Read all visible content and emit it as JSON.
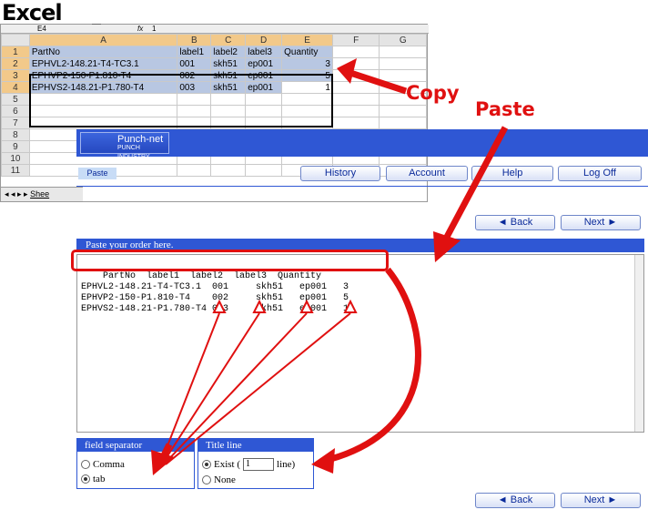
{
  "excel": {
    "title": "Excel",
    "name_box": "E4",
    "fx": "fx",
    "formula_value": "1",
    "columns": [
      "A",
      "B",
      "C",
      "D",
      "E",
      "F",
      "G"
    ],
    "rows": [
      {
        "num": "1",
        "cells": [
          "PartNo",
          "label1",
          "label2",
          "label3",
          "Quantity",
          "",
          ""
        ]
      },
      {
        "num": "2",
        "cells": [
          "EPHVL2-148.21-T4-TC3.1",
          "001",
          "skh51",
          "ep001",
          "3",
          "",
          ""
        ]
      },
      {
        "num": "3",
        "cells": [
          "EPHVP2-150-P1.810-T4",
          "002",
          "skh51",
          "ep001",
          "5",
          "",
          ""
        ]
      },
      {
        "num": "4",
        "cells": [
          "EPHVS2-148.21-P1.780-T4",
          "003",
          "skh51",
          "ep001",
          "1",
          "",
          ""
        ]
      },
      {
        "num": "5",
        "cells": [
          "",
          "",
          "",
          "",
          "",
          "",
          ""
        ]
      },
      {
        "num": "6",
        "cells": [
          "",
          "",
          "",
          "",
          "",
          "",
          ""
        ]
      },
      {
        "num": "7",
        "cells": [
          "",
          "",
          "",
          "",
          "",
          "",
          ""
        ]
      },
      {
        "num": "8",
        "cells": [
          "",
          "",
          "",
          "",
          "",
          "",
          ""
        ]
      },
      {
        "num": "9",
        "cells": [
          "",
          "",
          "",
          "",
          "",
          "",
          ""
        ]
      },
      {
        "num": "10",
        "cells": [
          "",
          "",
          "",
          "",
          "",
          "",
          ""
        ]
      },
      {
        "num": "11",
        "cells": [
          "",
          "",
          "",
          "",
          "",
          "",
          ""
        ]
      }
    ],
    "sheet_tab": "Shee"
  },
  "app": {
    "logo_line1": "Punch-net",
    "logo_line2": "PUNCH INDUSTRY",
    "paste_tab": "Paste",
    "nav": {
      "history": "History",
      "account": "Account",
      "help": "Help",
      "logoff": "Log Off"
    },
    "back": "Back",
    "next": "Next",
    "panel_title": "Paste your order here.",
    "paste_text": "PartNo  label1  label2  label3  Quantity\nEPHVL2-148.21-T4-TC3.1  001     skh51   ep001   3\nEPHVP2-150-P1.810-T4    002     skh51   ep001   5\nEPHVS2-148.21-P1.780-T4 003     skh51   ep001   1",
    "field_separator": {
      "title": "field separator",
      "opt1": "Comma",
      "opt2": "tab",
      "selected": "tab"
    },
    "title_line": {
      "title": "Title line",
      "exist_pre": "Exist (",
      "exist_value": "1",
      "exist_post": "line)",
      "none": "None",
      "selected": "exist"
    }
  },
  "annotations": {
    "copy": "Copy",
    "paste": "Paste"
  },
  "colors": {
    "accent": "#2f57d4",
    "annotation": "#e01010"
  }
}
